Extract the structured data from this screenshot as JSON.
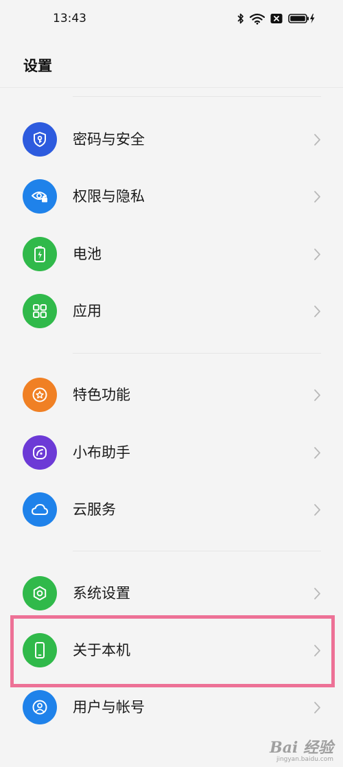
{
  "status_bar": {
    "time": "13:43",
    "icons": [
      "bluetooth-icon",
      "wifi-icon",
      "sim-off-icon",
      "battery-charging-icon"
    ]
  },
  "header": {
    "title": "设置"
  },
  "groups": [
    {
      "items": [
        {
          "label": "密码与安全",
          "icon": "shield-key-icon",
          "color": "#2d5bde"
        },
        {
          "label": "权限与隐私",
          "icon": "eye-lock-icon",
          "color": "#1f82ea"
        },
        {
          "label": "电池",
          "icon": "battery-icon",
          "color": "#30b94a"
        },
        {
          "label": "应用",
          "icon": "apps-grid-icon",
          "color": "#30b94a"
        }
      ]
    },
    {
      "items": [
        {
          "label": "特色功能",
          "icon": "star-icon",
          "color": "#f08024"
        },
        {
          "label": "小布助手",
          "icon": "assistant-icon",
          "color": "#6c3ad6"
        },
        {
          "label": "云服务",
          "icon": "cloud-icon",
          "color": "#1f82ea"
        }
      ]
    },
    {
      "items": [
        {
          "label": "系统设置",
          "icon": "hexagon-gear-icon",
          "color": "#30b94a"
        },
        {
          "label": "关于本机",
          "icon": "phone-icon",
          "color": "#30b94a",
          "highlighted": true
        },
        {
          "label": "用户与帐号",
          "icon": "user-icon",
          "color": "#1f82ea"
        }
      ]
    }
  ],
  "highlight": {
    "color": "#ed7196",
    "target": "关于本机"
  },
  "watermark": {
    "logo": "Bai 经验",
    "url": "jingyan.baidu.com"
  }
}
